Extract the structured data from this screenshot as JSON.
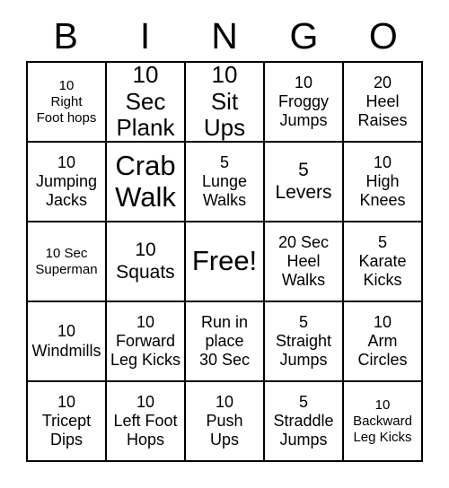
{
  "card": {
    "header_letters": [
      "B",
      "I",
      "N",
      "G",
      "O"
    ],
    "rows": [
      [
        {
          "text": "10\nRight\nFoot hops",
          "size": "sz-s"
        },
        {
          "text": "10 Sec\nPlank",
          "size": "sz-xl"
        },
        {
          "text": "10\nSit Ups",
          "size": "sz-xl"
        },
        {
          "text": "10\nFroggy\nJumps",
          "size": "sz-m"
        },
        {
          "text": "20\nHeel\nRaises",
          "size": "sz-m"
        }
      ],
      [
        {
          "text": "10\nJumping\nJacks",
          "size": "sz-m"
        },
        {
          "text": "Crab\nWalk",
          "size": "sz-xxl"
        },
        {
          "text": "5\nLunge\nWalks",
          "size": "sz-m"
        },
        {
          "text": "5\nLevers",
          "size": "sz-l"
        },
        {
          "text": "10\nHigh\nKnees",
          "size": "sz-m"
        }
      ],
      [
        {
          "text": "10 Sec\nSuperman",
          "size": "sz-s"
        },
        {
          "text": "10\nSquats",
          "size": "sz-l"
        },
        {
          "text": "Free!",
          "size": "sz-xxl"
        },
        {
          "text": "20 Sec\nHeel\nWalks",
          "size": "sz-m"
        },
        {
          "text": "5\nKarate\nKicks",
          "size": "sz-m"
        }
      ],
      [
        {
          "text": "10\nWindmills",
          "size": "sz-m"
        },
        {
          "text": "10\nForward\nLeg Kicks",
          "size": "sz-m"
        },
        {
          "text": "Run in\nplace\n30 Sec",
          "size": "sz-m"
        },
        {
          "text": "5\nStraight\nJumps",
          "size": "sz-m"
        },
        {
          "text": "10\nArm\nCircles",
          "size": "sz-m"
        }
      ],
      [
        {
          "text": "10\nTricept\nDips",
          "size": "sz-m"
        },
        {
          "text": "10\nLeft Foot\nHops",
          "size": "sz-m"
        },
        {
          "text": "10\nPush\nUps",
          "size": "sz-m"
        },
        {
          "text": "5\nStraddle\nJumps",
          "size": "sz-m"
        },
        {
          "text": "10\nBackward\nLeg Kicks",
          "size": "sz-s"
        }
      ]
    ],
    "colors": {
      "grid_line": "#000000",
      "background": "#ffffff",
      "text": "#000000"
    }
  }
}
